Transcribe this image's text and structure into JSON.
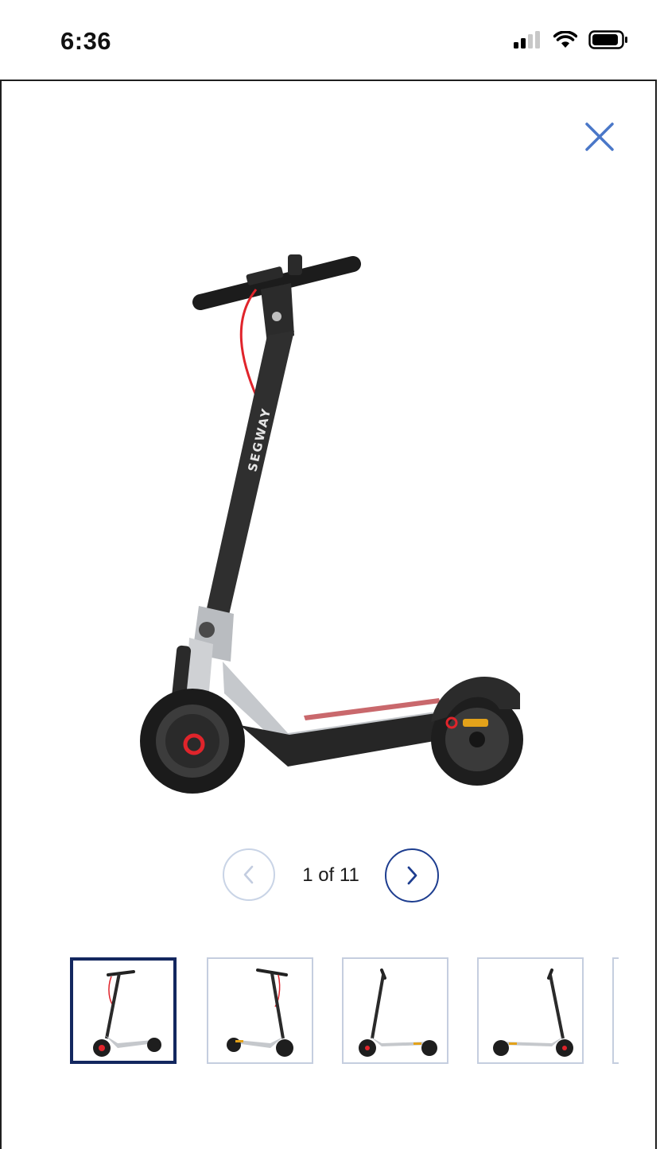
{
  "status_bar": {
    "time": "6:36"
  },
  "gallery": {
    "current": 1,
    "total": 11,
    "counter_text": "1 of 11",
    "thumbnail_count_visible": 5,
    "active_thumbnail": 1
  },
  "colors": {
    "accent": "#1d3d8f",
    "close_icon": "#4a77c8",
    "active_thumb_border": "#13275f",
    "inactive_border": "#c5cedf"
  },
  "icons": {
    "close": "close-icon",
    "prev": "chevron-left-icon",
    "next": "chevron-right-icon",
    "signal": "cellular-signal-icon",
    "wifi": "wifi-icon",
    "battery": "battery-icon"
  }
}
